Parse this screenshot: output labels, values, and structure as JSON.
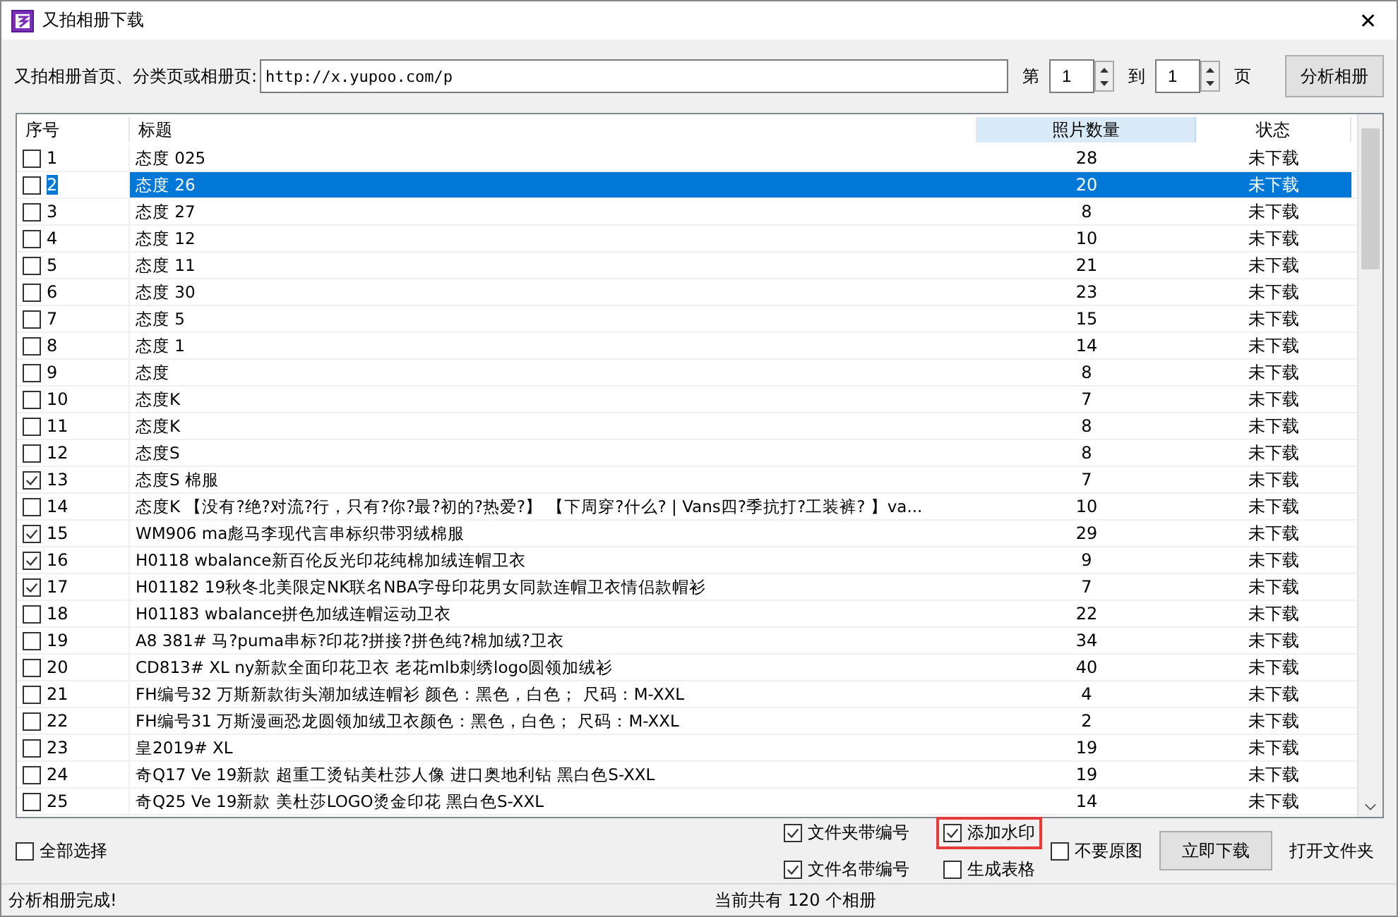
{
  "window": {
    "title": "又拍相册下载",
    "close": "✕"
  },
  "toolbar": {
    "url_label": "又拍相册首页、分类页或相册页:",
    "url_value": "http://x.yupoo.com/p",
    "from_label": "第",
    "from_value": "1",
    "to_label": "到",
    "to_value": "1",
    "page_label": "页",
    "analyze_button": "分析相册"
  },
  "table": {
    "columns": [
      {
        "label": "序号",
        "selected": false
      },
      {
        "label": "标题",
        "selected": false
      },
      {
        "label": "照片数量",
        "selected": true
      },
      {
        "label": "状态",
        "selected": false
      }
    ],
    "rows": [
      {
        "no": "1",
        "title": "态度 025",
        "count": "28",
        "status": "未下载",
        "checked": false,
        "selected": false
      },
      {
        "no": "2",
        "title": "态度 26",
        "count": "20",
        "status": "未下载",
        "checked": false,
        "selected": true
      },
      {
        "no": "3",
        "title": "态度 27",
        "count": "8",
        "status": "未下载",
        "checked": false,
        "selected": false
      },
      {
        "no": "4",
        "title": "态度 12",
        "count": "10",
        "status": "未下载",
        "checked": false,
        "selected": false
      },
      {
        "no": "5",
        "title": "态度 11",
        "count": "21",
        "status": "未下载",
        "checked": false,
        "selected": false
      },
      {
        "no": "6",
        "title": "态度 30",
        "count": "23",
        "status": "未下载",
        "checked": false,
        "selected": false
      },
      {
        "no": "7",
        "title": "态度 5",
        "count": "15",
        "status": "未下载",
        "checked": false,
        "selected": false
      },
      {
        "no": "8",
        "title": "态度 1",
        "count": "14",
        "status": "未下载",
        "checked": false,
        "selected": false
      },
      {
        "no": "9",
        "title": "态度",
        "count": "8",
        "status": "未下载",
        "checked": false,
        "selected": false
      },
      {
        "no": "10",
        "title": "态度K",
        "count": "7",
        "status": "未下载",
        "checked": false,
        "selected": false
      },
      {
        "no": "11",
        "title": "态度K",
        "count": "8",
        "status": "未下载",
        "checked": false,
        "selected": false
      },
      {
        "no": "12",
        "title": "态度S",
        "count": "8",
        "status": "未下载",
        "checked": false,
        "selected": false
      },
      {
        "no": "13",
        "title": "态度S   棉服",
        "count": "7",
        "status": "未下载",
        "checked": true,
        "selected": false
      },
      {
        "no": "14",
        "title": "态度K   【没有?绝?对流?行，只有?你?最?初的?热爱?】 【下周穿?什么? | Vans四?季抗打?工装裤? 】va...",
        "count": "10",
        "status": "未下载",
        "checked": false,
        "selected": false
      },
      {
        "no": "15",
        "title": "WM906   ma彪马李现代言串标织带羽绒棉服",
        "count": "29",
        "status": "未下载",
        "checked": true,
        "selected": false
      },
      {
        "no": "16",
        "title": "H0118   wbalance新百伦反光印花纯棉加绒连帽卫衣",
        "count": "9",
        "status": "未下载",
        "checked": true,
        "selected": false
      },
      {
        "no": "17",
        "title": "H01182   19秋冬北美限定NK联名NBA字母印花男女同款连帽卫衣情侣款帽衫",
        "count": "7",
        "status": "未下载",
        "checked": true,
        "selected": false
      },
      {
        "no": "18",
        "title": "H01183   wbalance拼色加绒连帽运动卫衣",
        "count": "22",
        "status": "未下载",
        "checked": false,
        "selected": false
      },
      {
        "no": "19",
        "title": "A8 381#   马?puma串标?印花?拼接?拼色纯?棉加绒?卫衣",
        "count": "34",
        "status": "未下载",
        "checked": false,
        "selected": false
      },
      {
        "no": "20",
        "title": "CD813#   XL ny新款全面印花卫衣 老花mlb刺绣logo圆领加绒衫",
        "count": "40",
        "status": "未下载",
        "checked": false,
        "selected": false
      },
      {
        "no": "21",
        "title": "FH编号32   万斯新款街头潮加绒连帽衫 颜色：黑色，白色； 尺码：M-XXL",
        "count": "4",
        "status": "未下载",
        "checked": false,
        "selected": false
      },
      {
        "no": "22",
        "title": "FH编号31   万斯漫画恐龙圆领加绒卫衣颜色：黑色，白色； 尺码：M-XXL",
        "count": "2",
        "status": "未下载",
        "checked": false,
        "selected": false
      },
      {
        "no": "23",
        "title": "皇2019#   XL",
        "count": "19",
        "status": "未下载",
        "checked": false,
        "selected": false
      },
      {
        "no": "24",
        "title": "奇Q17 Ve   19新款 超重工烫钻美杜莎人像 进口奥地利钻 黑白色S-XXL",
        "count": "19",
        "status": "未下载",
        "checked": false,
        "selected": false
      },
      {
        "no": "25",
        "title": "奇Q25 Ve   19新款 美杜莎LOGO烫金印花 黑白色S-XXL",
        "count": "14",
        "status": "未下载",
        "checked": false,
        "selected": false
      }
    ]
  },
  "select_all": {
    "label": "全部选择",
    "checked": false
  },
  "options": [
    {
      "label": "文件夹带编号",
      "checked": true,
      "highlighted": false
    },
    {
      "label": "添加水印",
      "checked": true,
      "highlighted": true
    },
    {
      "label": "文件名带编号",
      "checked": true,
      "highlighted": false
    },
    {
      "label": "生成表格",
      "checked": false,
      "highlighted": false
    }
  ],
  "original_option": {
    "label": "不要原图",
    "checked": false
  },
  "download_button": "立即下载",
  "open_folder_button": "打开文件夹",
  "status_bar": {
    "message": "分析相册完成!",
    "total": "当前共有 120 个相册"
  }
}
